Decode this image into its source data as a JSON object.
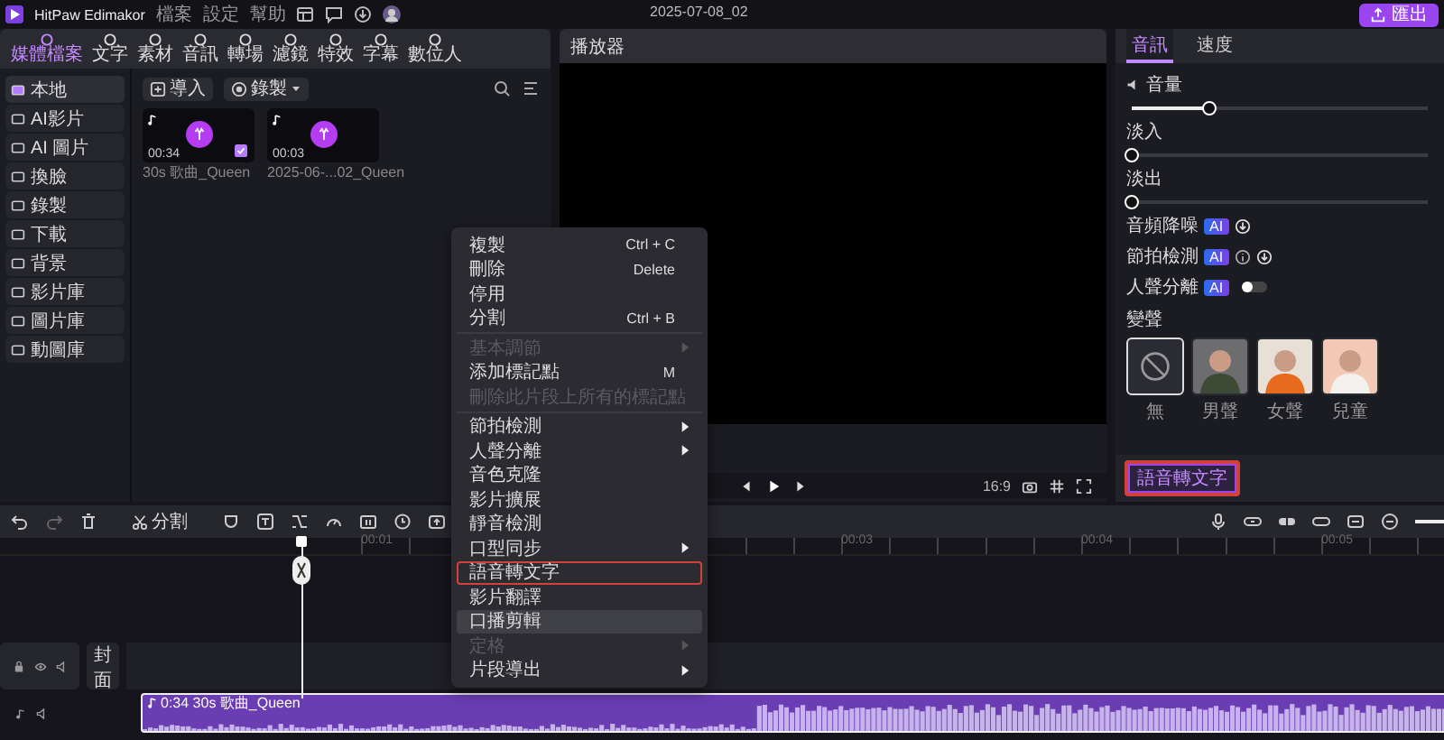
{
  "app": {
    "title": "HitPaw Edimakor",
    "menu": [
      "檔案",
      "設定",
      "幫助"
    ],
    "project": "2025-07-08_02",
    "export": "匯出"
  },
  "media_tabs": [
    {
      "label": "媒體檔案",
      "selected": true
    },
    {
      "label": "文字",
      "selected": false
    },
    {
      "label": "素材",
      "selected": false
    },
    {
      "label": "音訊",
      "selected": false
    },
    {
      "label": "轉場",
      "selected": false
    },
    {
      "label": "濾鏡",
      "selected": false
    },
    {
      "label": "特效",
      "selected": false
    },
    {
      "label": "字幕",
      "selected": false
    },
    {
      "label": "數位人",
      "selected": false
    }
  ],
  "sidebar": [
    {
      "label": "本地",
      "selected": true
    },
    {
      "label": "AI影片",
      "selected": false
    },
    {
      "label": "AI 圖片",
      "selected": false
    },
    {
      "label": "換臉",
      "selected": false
    },
    {
      "label": "錄製",
      "selected": false
    },
    {
      "label": "下載",
      "selected": false
    },
    {
      "label": "背景",
      "selected": false
    },
    {
      "label": "影片庫",
      "selected": false
    },
    {
      "label": "圖片庫",
      "selected": false
    },
    {
      "label": "動圖庫",
      "selected": false
    }
  ],
  "toolbar": {
    "import": "導入",
    "record": "錄製"
  },
  "media": [
    {
      "duration": "00:34",
      "name": "30s 歌曲_Queen",
      "checked": true
    },
    {
      "duration": "00:03",
      "name": "2025-06-...02_Queen",
      "checked": false
    }
  ],
  "player": {
    "title": "播放器",
    "aspect": "16:9"
  },
  "inspector": {
    "tabs": [
      {
        "label": "音訊",
        "selected": true
      },
      {
        "label": "速度",
        "selected": false
      }
    ],
    "sliders": [
      {
        "label": "音量",
        "level": 0.26
      },
      {
        "label": "淡入",
        "level": 0
      },
      {
        "label": "淡出",
        "level": 0
      }
    ],
    "ai_tools": [
      {
        "label": "音頻降噪",
        "badge": "AI",
        "kind": "download"
      },
      {
        "label": "節拍檢測",
        "badge": "AI",
        "kind": "info"
      },
      {
        "label": "人聲分離",
        "badge": "AI",
        "kind": "toggle",
        "on": false
      }
    ],
    "voice_title": "變聲",
    "voices": [
      {
        "label": "無",
        "kind": "none",
        "selected": true
      },
      {
        "label": "男聲",
        "kind": "man",
        "selected": false
      },
      {
        "label": "女聲",
        "kind": "woman",
        "selected": false
      },
      {
        "label": "兒童",
        "kind": "child",
        "selected": false
      }
    ],
    "action": "語音轉文字"
  },
  "timeline": {
    "split": "分割",
    "ticks": [
      {
        "label": "00:01"
      },
      {
        "label": "00:03"
      },
      {
        "label": "00:04"
      },
      {
        "label": "00:05"
      }
    ],
    "cover": "封面",
    "clip": "0:34 30s 歌曲_Queen"
  },
  "context_menu": [
    [
      {
        "label": "複製",
        "shortcut": "Ctrl + C",
        "disabled": false,
        "submenu": false,
        "outlined": false,
        "hovered": false
      },
      {
        "label": "刪除",
        "shortcut": "Delete",
        "disabled": false,
        "submenu": false,
        "outlined": false,
        "hovered": false
      },
      {
        "label": "停用",
        "disabled": false,
        "submenu": false,
        "outlined": false,
        "hovered": false
      },
      {
        "label": "分割",
        "shortcut": "Ctrl + B",
        "disabled": false,
        "submenu": false,
        "outlined": false,
        "hovered": false
      }
    ],
    [
      {
        "label": "基本調節",
        "disabled": true,
        "submenu": true,
        "outlined": false,
        "hovered": false
      },
      {
        "label": "添加標記點",
        "shortcut": "M",
        "disabled": false,
        "submenu": false,
        "outlined": false,
        "hovered": false
      },
      {
        "label": "刪除此片段上所有的標記點",
        "disabled": true,
        "submenu": false,
        "outlined": false,
        "hovered": false
      }
    ],
    [
      {
        "label": "節拍檢測",
        "disabled": false,
        "submenu": true,
        "outlined": false,
        "hovered": false
      },
      {
        "label": "人聲分離",
        "disabled": false,
        "submenu": true,
        "outlined": false,
        "hovered": false
      },
      {
        "label": "音色克隆",
        "disabled": false,
        "submenu": false,
        "outlined": false,
        "hovered": false
      },
      {
        "label": "影片擴展",
        "disabled": false,
        "submenu": false,
        "outlined": false,
        "hovered": false
      },
      {
        "label": "靜音檢測",
        "disabled": false,
        "submenu": false,
        "outlined": false,
        "hovered": false
      },
      {
        "label": "口型同步",
        "disabled": false,
        "submenu": true,
        "outlined": false,
        "hovered": false
      },
      {
        "label": "語音轉文字",
        "disabled": false,
        "submenu": false,
        "outlined": true,
        "hovered": false
      },
      {
        "label": "影片翻譯",
        "disabled": false,
        "submenu": false,
        "outlined": false,
        "hovered": false
      },
      {
        "label": "口播剪輯",
        "disabled": false,
        "submenu": false,
        "outlined": false,
        "hovered": true
      },
      {
        "label": "定格",
        "disabled": true,
        "submenu": true,
        "outlined": false,
        "hovered": false
      },
      {
        "label": "片段導出",
        "disabled": false,
        "submenu": true,
        "outlined": false,
        "hovered": false
      }
    ]
  ]
}
